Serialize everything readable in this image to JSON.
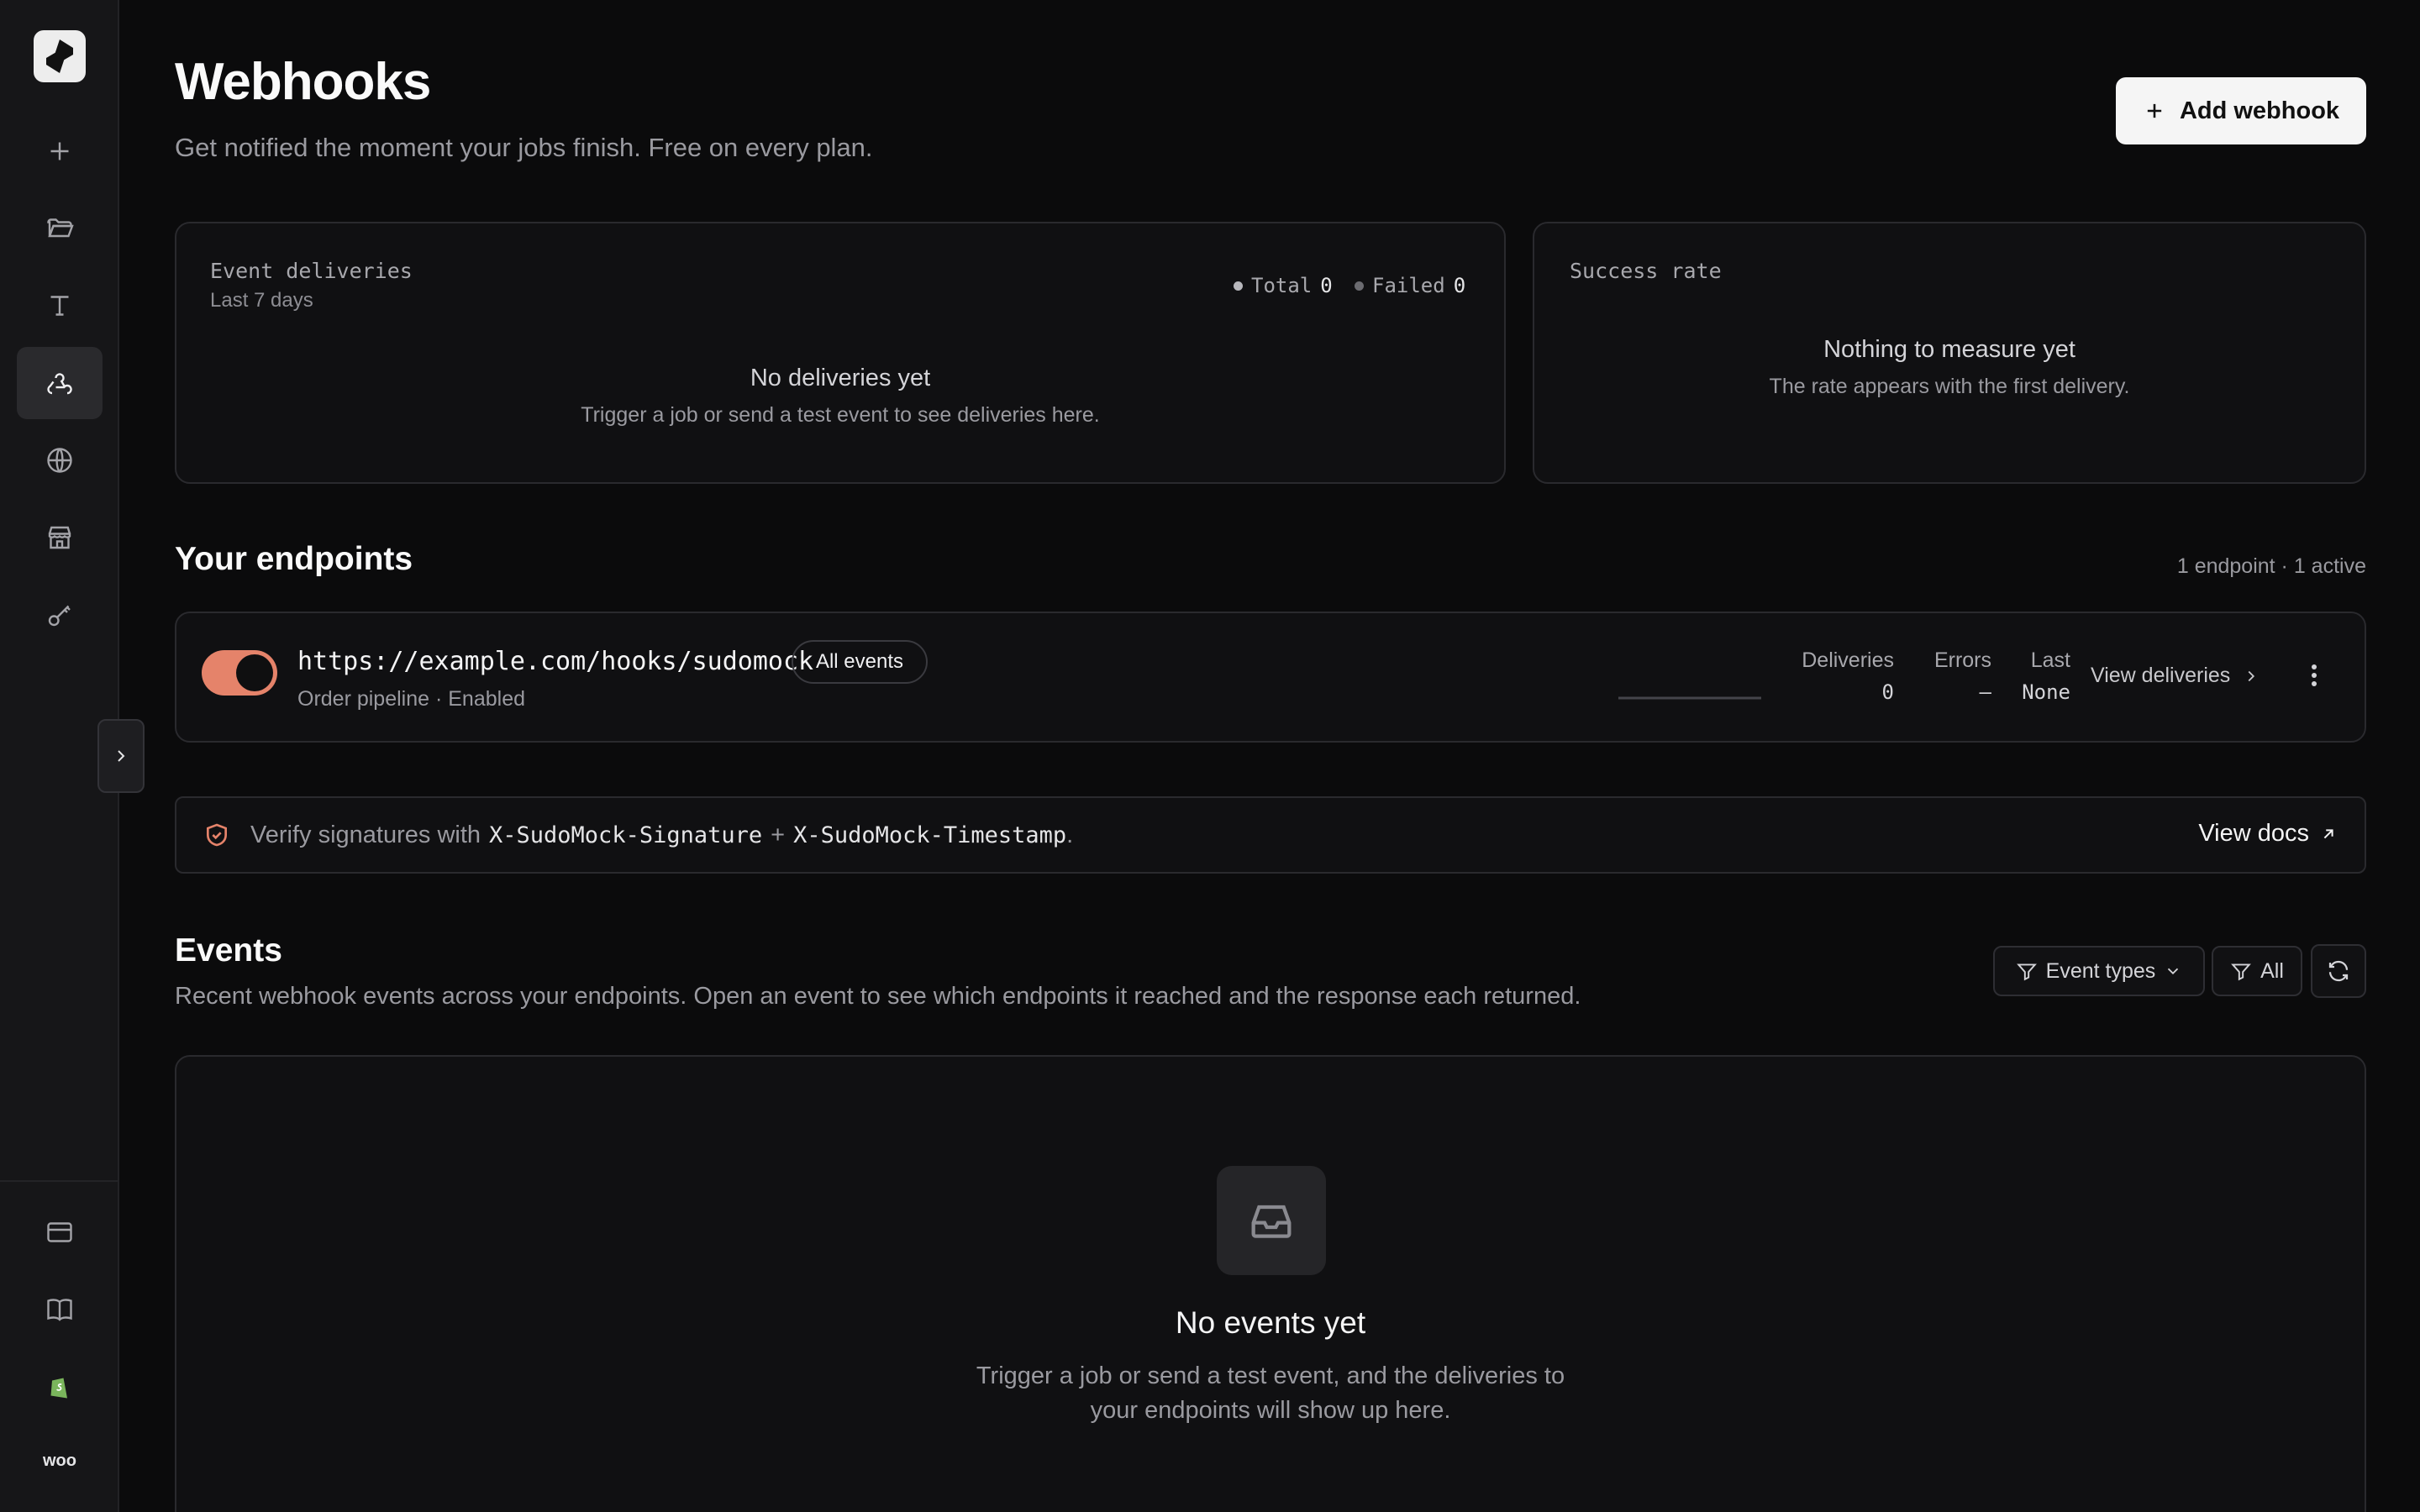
{
  "header": {
    "title": "Webhooks",
    "subtitle": "Get notified the moment your jobs finish. Free on every plan.",
    "add_button": "Add webhook"
  },
  "deliveries_card": {
    "label": "Event deliveries",
    "period": "Last 7 days",
    "total_label": "Total",
    "total_value": "0",
    "failed_label": "Failed",
    "failed_value": "0",
    "empty_title": "No deliveries yet",
    "empty_sub": "Trigger a job or send a test event to see deliveries here."
  },
  "success_card": {
    "label": "Success rate",
    "empty_title": "Nothing to measure yet",
    "empty_sub": "The rate appears with the first delivery."
  },
  "endpoints": {
    "title": "Your endpoints",
    "meta": "1 endpoint · 1 active",
    "items": [
      {
        "url": "https://example.com/hooks/sudomock",
        "filter": "All events",
        "description": "Order pipeline · Enabled",
        "enabled": true,
        "deliveries_label": "Deliveries",
        "deliveries_value": "0",
        "errors_label": "Errors",
        "errors_value": "–",
        "last_label": "Last",
        "last_value": "None",
        "view_label": "View deliveries"
      }
    ]
  },
  "verify": {
    "prefix": "Verify signatures with",
    "header_sig": "X-SudoMock-Signature",
    "plus": "+",
    "header_ts": "X-SudoMock-Timestamp",
    "suffix": ".",
    "docs_label": "View docs"
  },
  "events": {
    "title": "Events",
    "subtitle": "Recent webhook events across your endpoints. Open an event to see which endpoints it reached and the response each returned.",
    "filter_types": "Event types",
    "filter_status": "All",
    "empty_title": "No events yet",
    "empty_sub_line1": "Trigger a job or send a test event, and the deliveries to",
    "empty_sub_line2": "your endpoints will show up here."
  },
  "sidebar": {
    "items": [
      "plus-icon",
      "folder-icon",
      "text-icon",
      "webhook-icon",
      "globe-icon",
      "store-icon",
      "key-icon"
    ],
    "bottom": [
      "credit-card-icon",
      "book-icon",
      "shopify-icon",
      "woo-icon"
    ],
    "woo_label": "woo"
  },
  "colors": {
    "accent": "#e5836a",
    "background": "#0b0b0c",
    "card": "#101012"
  }
}
